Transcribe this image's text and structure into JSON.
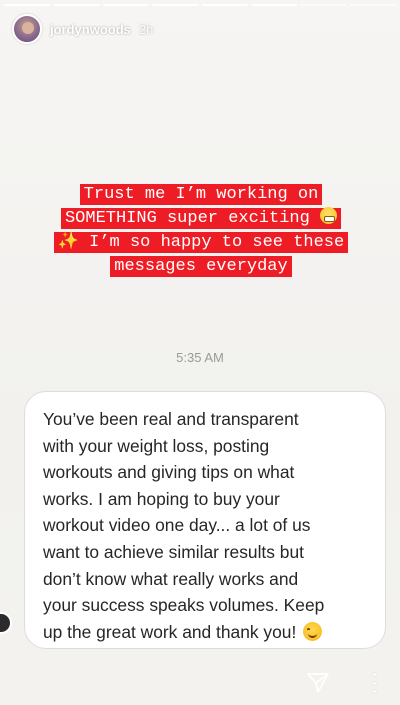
{
  "story": {
    "progress_segments": 8,
    "progress_completed": 6
  },
  "header": {
    "username": "jordynwoods",
    "time_ago": "2h"
  },
  "caption": {
    "lines": [
      "Trust me I’m working on",
      "SOMETHING super exciting",
      "I’m so happy to see these",
      "messages everyday"
    ],
    "highlight_color": "#ee1c25"
  },
  "message": {
    "timestamp": "5:35 AM",
    "lines": [
      "You’ve been real and transparent",
      "with your weight loss, posting",
      "workouts and giving tips on what",
      "works. I am hoping to buy your",
      "workout video one day... a lot of us",
      "want to achieve similar results but",
      "don’t know what really works and",
      "your success speaks volumes. Keep",
      "up the great work and thank you!"
    ]
  },
  "icons": {
    "send": "send-icon",
    "more": "more-options-icon",
    "sparkles": "sparkles-icon",
    "grimace": "grimace-emoji-icon",
    "smile": "smile-emoji-icon"
  }
}
